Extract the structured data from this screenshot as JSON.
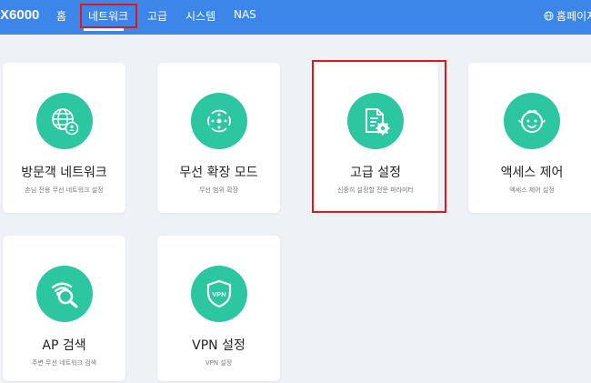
{
  "header": {
    "brand": "X6000",
    "nav": [
      "홈",
      "네트워크",
      "고급",
      "시스템",
      "NAS"
    ],
    "active_nav": "네트워크",
    "home_link": "홈페이지"
  },
  "cards": [
    {
      "title": "방문객 네트워크",
      "desc": "손님 전용 무선 네트워크 설정",
      "icon": "globe-user-icon"
    },
    {
      "title": "무선 확장 모드",
      "desc": "무선 범위 확장",
      "icon": "signal-extend-icon"
    },
    {
      "title": "고급 설정",
      "desc": "신중히 설정할 전문 파라미터",
      "icon": "document-gear-icon"
    },
    {
      "title": "액세스 제어",
      "desc": "액세스 제어 설정",
      "icon": "child-face-icon"
    },
    {
      "title": "AP 검색",
      "desc": "주변 무선 네트워크 검색",
      "icon": "wifi-search-icon"
    },
    {
      "title": "VPN 설정",
      "desc": "VPN 설정",
      "icon": "vpn-shield-icon"
    }
  ],
  "colors": {
    "topbar": "#3d86e9",
    "icon_bg": "#2cc6a0",
    "highlight": "#e01818",
    "page_bg": "#eef2f6"
  }
}
